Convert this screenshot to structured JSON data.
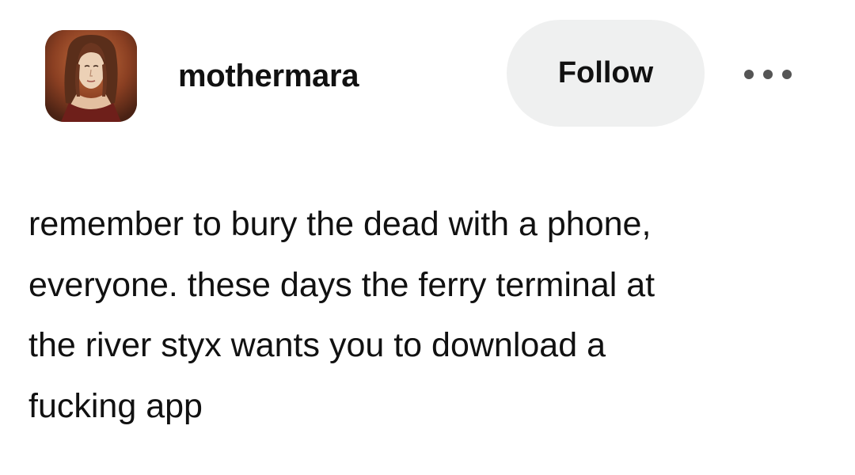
{
  "post": {
    "author": {
      "username": "mothermara",
      "avatar_icon": "portrait-avatar-icon"
    },
    "follow_label": "Follow",
    "more_icon": "more-options-icon",
    "body_lines": [
      "remember to bury the dead with a phone,",
      "everyone. these days the ferry terminal at",
      "the river styx wants you to download a",
      "fucking app"
    ]
  },
  "colors": {
    "background": "#ffffff",
    "text": "#111111",
    "follow_button_bg": "#eff0f0",
    "more_dots": "#555555"
  }
}
